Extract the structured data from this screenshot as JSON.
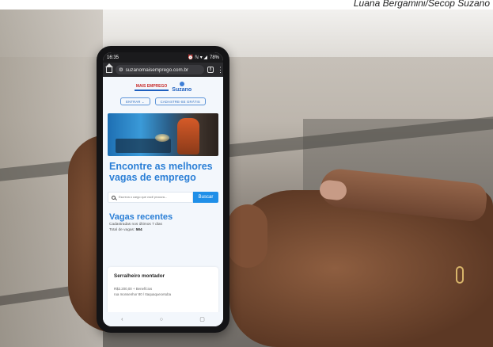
{
  "credit": "Luana Bergamini/Secop Suzano",
  "phone": {
    "status": {
      "time": "16:35",
      "icons": "⏰ ℕ ▾ ◢",
      "battery": "78%"
    },
    "browser": {
      "url": "suzanomaisemprego.com.br",
      "tabs_count": "8"
    },
    "site": {
      "logo_left": "MAIS EMPREGO",
      "logo_right": "Suzano",
      "login_label": "ENTRAR",
      "register_label": "CADASTRE-SE GRÁTIS",
      "headline": "Encontre as melhores vagas de emprego",
      "search_placeholder": "Escreva o cargo que você procura...",
      "search_button": "Buscar",
      "recent_title": "Vagas recentes",
      "recent_subtitle": "Cadastradas nos últimos 7 dias",
      "total_label": "Total de vagas:",
      "total_value": "584",
      "job": {
        "title": "Serralheiro montador",
        "salary": "R$2.200,00 + Benefícios",
        "address": "rua monsenhor 80 / Itaquaquecetuba"
      }
    },
    "nav": {
      "back": "‹",
      "home": "○",
      "recents": "▢"
    }
  }
}
